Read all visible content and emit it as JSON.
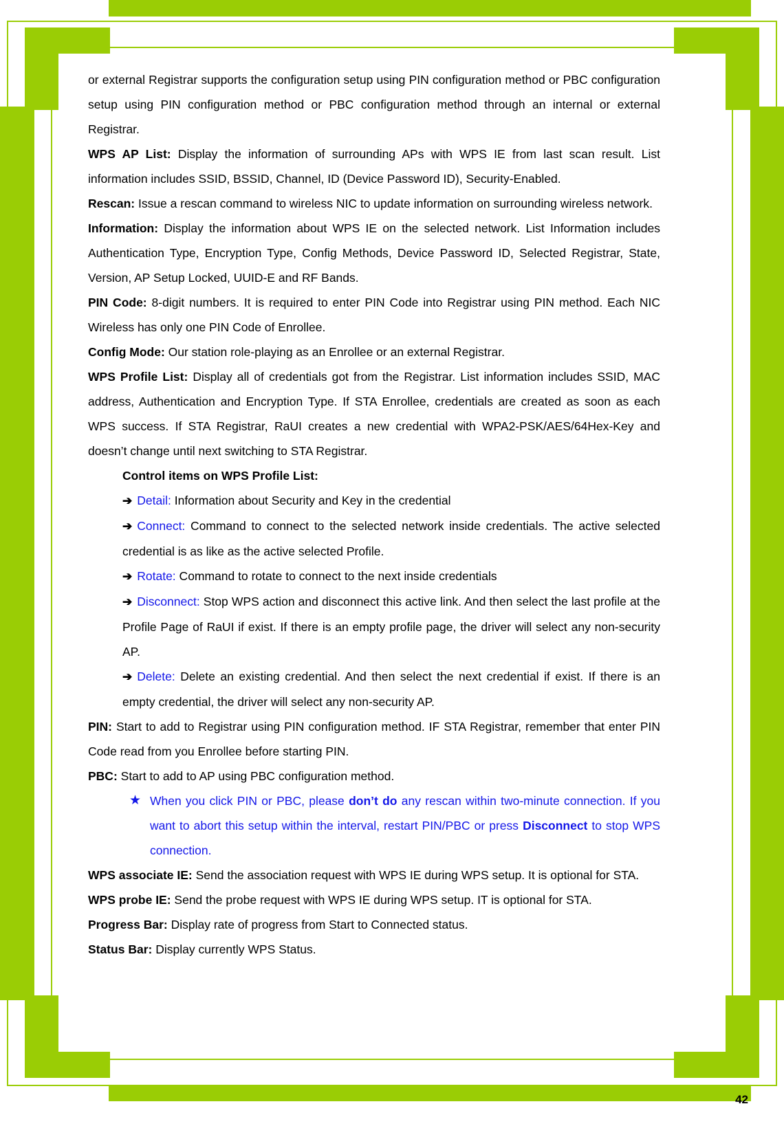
{
  "document": {
    "page_number": "42",
    "accent_color": "#9ACD05",
    "link_color": "#1417E8",
    "paragraphs": [
      {
        "id": "intro",
        "lead": "",
        "text": "or external Registrar supports the configuration setup using PIN configuration method or PBC configuration setup using PIN configuration method or PBC configuration method through an internal or external Registrar."
      },
      {
        "id": "wps-ap-list",
        "lead": "WPS AP List:",
        "text": " Display the information of surrounding APs with WPS IE from last scan result. List information includes SSID, BSSID, Channel, ID (Device Password ID), Security-Enabled."
      },
      {
        "id": "rescan",
        "lead": "Rescan:",
        "text": " Issue a rescan command to wireless NIC to update information on surrounding wireless network."
      },
      {
        "id": "information",
        "lead": "Information:",
        "text": " Display the information about WPS IE on the selected network. List Information includes Authentication Type, Encryption Type, Config Methods, Device Password ID, Selected Registrar, State, Version, AP Setup Locked, UUID-E and RF Bands."
      },
      {
        "id": "pin-code",
        "lead": "PIN Code:",
        "text": " 8-digit numbers. It is required to enter PIN Code into Registrar using PIN method. Each NIC Wireless has only one PIN Code of Enrollee."
      },
      {
        "id": "config-mode",
        "lead": "Config Mode:",
        "text": " Our station role-playing as an Enrollee or an external Registrar."
      },
      {
        "id": "wps-profile-list",
        "lead": "WPS Profile List:",
        "text": " Display all of credentials got from the Registrar. List information includes SSID, MAC address, Authentication and Encryption Type. If STA Enrollee, credentials are created as soon as each WPS success. If STA Registrar, RaUI creates a new credential with WPA2-PSK/AES/64Hex-Key and doesn’t change until next switching to STA Registrar."
      }
    ],
    "control_items": {
      "heading": "Control items on WPS Profile List:",
      "arrow_glyph": "➔",
      "items": [
        {
          "id": "detail",
          "label": "Detail:",
          "text": " Information about Security and Key in the credential"
        },
        {
          "id": "connect",
          "label": "Connect:",
          "text": " Command to connect to the selected network inside credentials. The active selected credential is as like as the active selected Profile."
        },
        {
          "id": "rotate",
          "label": "Rotate:",
          "text": " Command to rotate to connect to the next inside credentials"
        },
        {
          "id": "disconnect",
          "label": "Disconnect:",
          "text": " Stop WPS action and disconnect this active link. And then select the last profile at the Profile Page of RaUI if exist. If there is an empty profile page, the driver will select any non-security AP."
        },
        {
          "id": "delete",
          "label": "Delete:",
          "text": " Delete an existing credential. And then select the next credential if exist. If there is an empty credential, the driver will select any non-security AP."
        }
      ]
    },
    "paragraphs_after_controls": [
      {
        "id": "pin",
        "lead": "PIN:",
        "text": " Start to add to Registrar using PIN configuration method. IF STA Registrar, remember that enter PIN Code read from you Enrollee before starting PIN."
      },
      {
        "id": "pbc",
        "lead": "PBC:",
        "text": " Start to add to AP using PBC configuration method."
      }
    ],
    "note": {
      "star_glyph": "★",
      "part1": "When you click PIN or PBC, please ",
      "bold1": "don’t do",
      "part2": " any rescan within two-minute connection. If you want to abort this setup within the interval, restart PIN/PBC or press ",
      "bold2": "Disconnect",
      "part3": " to stop WPS connection."
    },
    "paragraphs_tail": [
      {
        "id": "wps-associate-ie",
        "lead": "WPS associate IE:",
        "text": " Send the association request with WPS IE during WPS setup. It is optional for STA."
      },
      {
        "id": "wps-probe-ie",
        "lead": "WPS probe IE:",
        "text": " Send the probe request with WPS IE during WPS setup. IT is optional for STA."
      },
      {
        "id": "progress-bar",
        "lead": "Progress Bar:",
        "text": " Display rate of progress from Start to Connected status."
      },
      {
        "id": "status-bar",
        "lead": "Status Bar:",
        "text": " Display currently WPS Status."
      }
    ]
  }
}
